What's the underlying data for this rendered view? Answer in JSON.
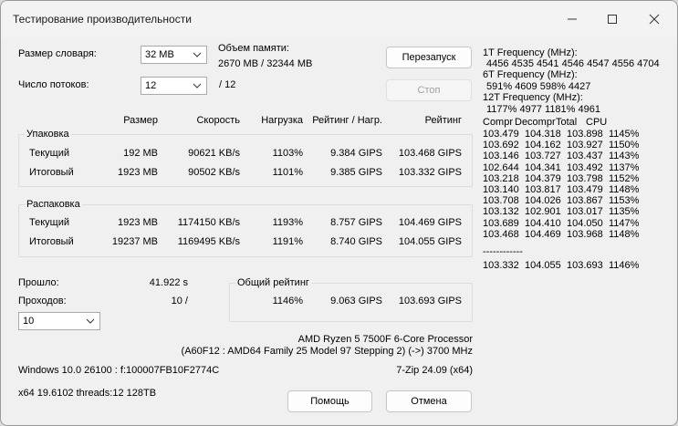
{
  "window": {
    "title": "Тестирование производительности"
  },
  "settings": {
    "dict_label": "Размер словаря:",
    "dict_value": "32 MB",
    "threads_label": "Число потоков:",
    "threads_value": "12",
    "threads_max": "/ 12",
    "mem_label": "Объем памяти:",
    "mem_value": "2670 MB / 32344 MB"
  },
  "buttons": {
    "restart": "Перезапуск",
    "stop": "Стоп",
    "help": "Помощь",
    "cancel": "Отмена"
  },
  "headers": {
    "size": "Размер",
    "speed": "Скорость",
    "load": "Нагрузка",
    "rating_load": "Рейтинг / Нагр.",
    "rating": "Рейтинг"
  },
  "compress": {
    "title": "Упаковка",
    "rows": [
      {
        "label": "Текущий",
        "size": "192 MB",
        "speed": "90621 KB/s",
        "load": "1103%",
        "rating_load": "9.384 GIPS",
        "rating": "103.468 GIPS"
      },
      {
        "label": "Итоговый",
        "size": "1923 MB",
        "speed": "90502 KB/s",
        "load": "1101%",
        "rating_load": "9.385 GIPS",
        "rating": "103.332 GIPS"
      }
    ]
  },
  "decompress": {
    "title": "Распаковка",
    "rows": [
      {
        "label": "Текущий",
        "size": "1923 MB",
        "speed": "1174150 KB/s",
        "load": "1193%",
        "rating_load": "8.757 GIPS",
        "rating": "104.469 GIPS"
      },
      {
        "label": "Итоговый",
        "size": "19237 MB",
        "speed": "1169495 KB/s",
        "load": "1191%",
        "rating_load": "8.740 GIPS",
        "rating": "104.055 GIPS"
      }
    ]
  },
  "elapsed": {
    "label": "Прошло:",
    "value": "41.922 s"
  },
  "passes": {
    "label": "Проходов:",
    "value": "10 /",
    "select": "10"
  },
  "total": {
    "title": "Общий рейтинг",
    "load": "1146%",
    "rating_load": "9.063 GIPS",
    "rating": "103.693 GIPS"
  },
  "cpu": {
    "line1": "AMD Ryzen 5 7500F 6-Core Processor",
    "line2": "(A60F12 : AMD64 Family 25 Model 97 Stepping 2) (->) 3700 MHz"
  },
  "sys": {
    "os": "Windows 10.0 26100 : f:100007FB10F2774C",
    "version": "7-Zip 24.09 (x64)",
    "build": "x64 19.6102 threads:12 128TB"
  },
  "right_panel": {
    "freq1_label": "1T Frequency (MHz):",
    "freq1_values": "4456 4535 4541 4546 4547 4556 4704",
    "freq6_label": "6T Frequency (MHz):",
    "freq6_values": "591% 4609 598% 4427",
    "freq12_label": "12T Frequency (MHz):",
    "freq12_values": "1177% 4977 1181% 4961",
    "table_header": [
      "Compr",
      "Decompr",
      "Total",
      "CPU"
    ],
    "rows": [
      [
        "103.479",
        "104.318",
        "103.898",
        "1145%"
      ],
      [
        "103.692",
        "104.162",
        "103.927",
        "1150%"
      ],
      [
        "103.146",
        "103.727",
        "103.437",
        "1143%"
      ],
      [
        "102.644",
        "104.341",
        "103.492",
        "1137%"
      ],
      [
        "103.218",
        "104.379",
        "103.798",
        "1152%"
      ],
      [
        "103.140",
        "103.817",
        "103.479",
        "1148%"
      ],
      [
        "103.708",
        "104.026",
        "103.867",
        "1153%"
      ],
      [
        "103.132",
        "102.901",
        "103.017",
        "1135%"
      ],
      [
        "103.689",
        "104.410",
        "104.050",
        "1147%"
      ],
      [
        "103.468",
        "104.469",
        "103.968",
        "1148%"
      ]
    ],
    "separator": "------------",
    "summary": [
      "103.332",
      "104.055",
      "103.693",
      "1146%"
    ]
  }
}
